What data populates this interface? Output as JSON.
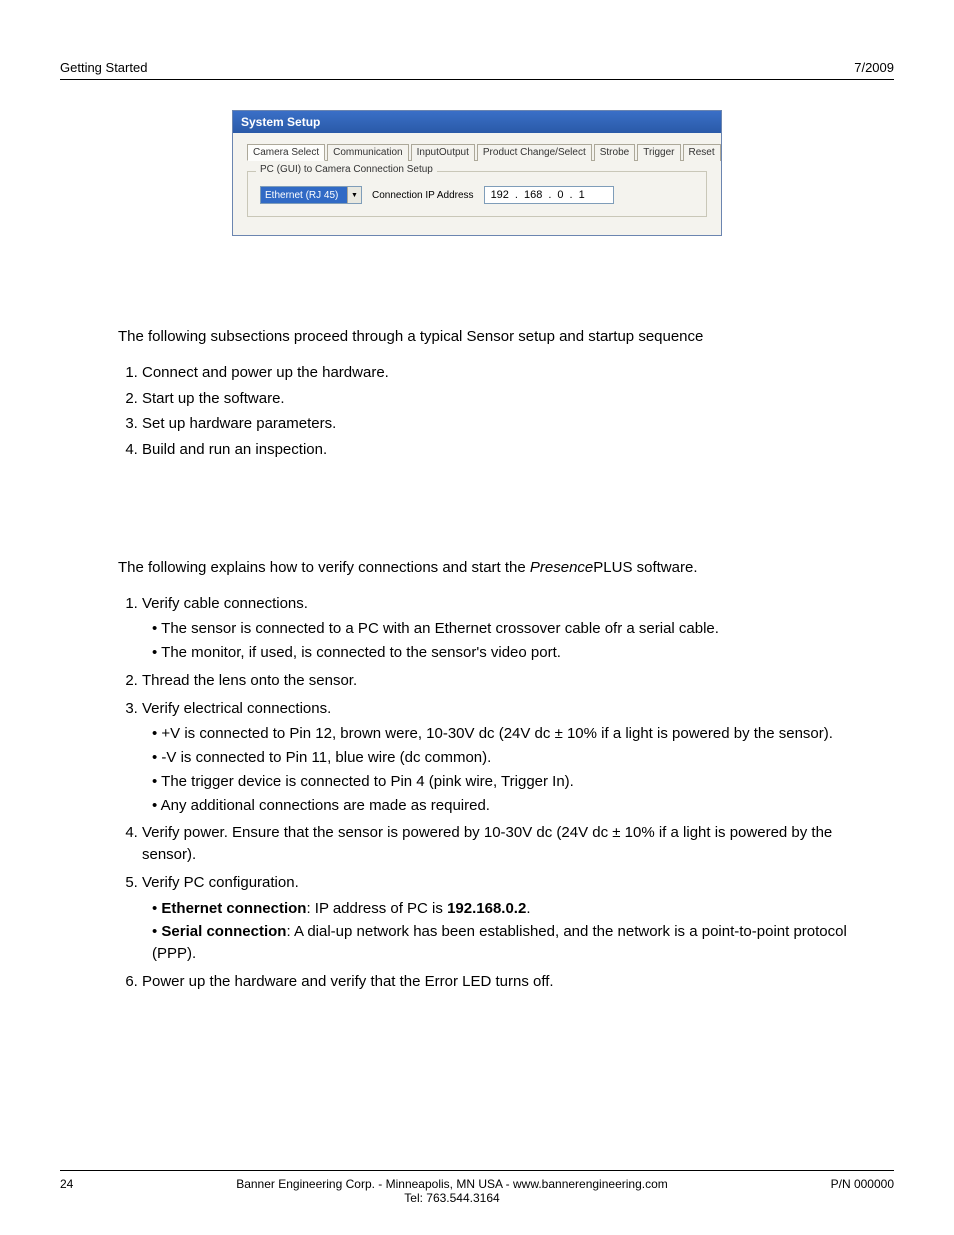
{
  "header": {
    "left": "Getting Started",
    "right": "7/2009"
  },
  "screenshot": {
    "title": "System Setup",
    "tabs": [
      "Camera Select",
      "Communication",
      "InputOutput",
      "Product Change/Select",
      "Strobe",
      "Trigger",
      "Reset"
    ],
    "groupbox_label": "PC (GUI) to Camera Connection Setup",
    "combo_value": "Ethernet (RJ 45)",
    "ip_label": "Connection IP Address",
    "ip_parts": [
      "192",
      "168",
      "0",
      "1"
    ]
  },
  "section1": {
    "intro": "The following subsections proceed through a typical Sensor setup and startup sequence",
    "steps": [
      "Connect and power up the hardware.",
      "Start up the software.",
      "Set up hardware parameters.",
      "Build and run an inspection."
    ]
  },
  "section2": {
    "intro_pre": "The following explains how to verify connections and start the ",
    "intro_em": "Presence",
    "intro_post": "PLUS software.",
    "steps": [
      {
        "text": "Verify cable connections.",
        "subs": [
          "The sensor is connected to a PC with an Ethernet crossover cable ofr a serial cable.",
          "The monitor, if used, is connected to the sensor's video port."
        ]
      },
      {
        "text": "Thread the lens onto the sensor.",
        "subs": []
      },
      {
        "text": "Verify electrical connections.",
        "subs": [
          "+V is connected to Pin 12, brown were, 10-30V dc (24V dc ± 10% if a light is powered by the sensor).",
          "-V is connected to Pin 11, blue wire (dc common).",
          "The trigger device is connected to Pin 4 (pink wire, Trigger In).",
          "Any additional connections are made as required."
        ]
      },
      {
        "text": "Verify power. Ensure that the sensor is powered by 10-30V dc (24V dc ± 10% if a light is powered by the sensor).",
        "subs": []
      },
      {
        "text": "Verify PC configuration.",
        "rich_subs": [
          {
            "bold1": "Ethernet connection",
            "mid": ": IP address of PC is ",
            "bold2": "192.168.0.2",
            "tail": "."
          },
          {
            "bold1": "Serial connection",
            "mid": ": A dial-up network has been established, and the network is a point-to-point protocol (PPP).",
            "bold2": "",
            "tail": ""
          }
        ]
      },
      {
        "text": "Power up the hardware and verify that the Error LED turns off.",
        "subs": []
      }
    ]
  },
  "footer": {
    "page": "24",
    "center1": "Banner Engineering Corp. - Minneapolis, MN USA - www.bannerengineering.com",
    "center2": "Tel: 763.544.3164",
    "right": "P/N 000000"
  }
}
